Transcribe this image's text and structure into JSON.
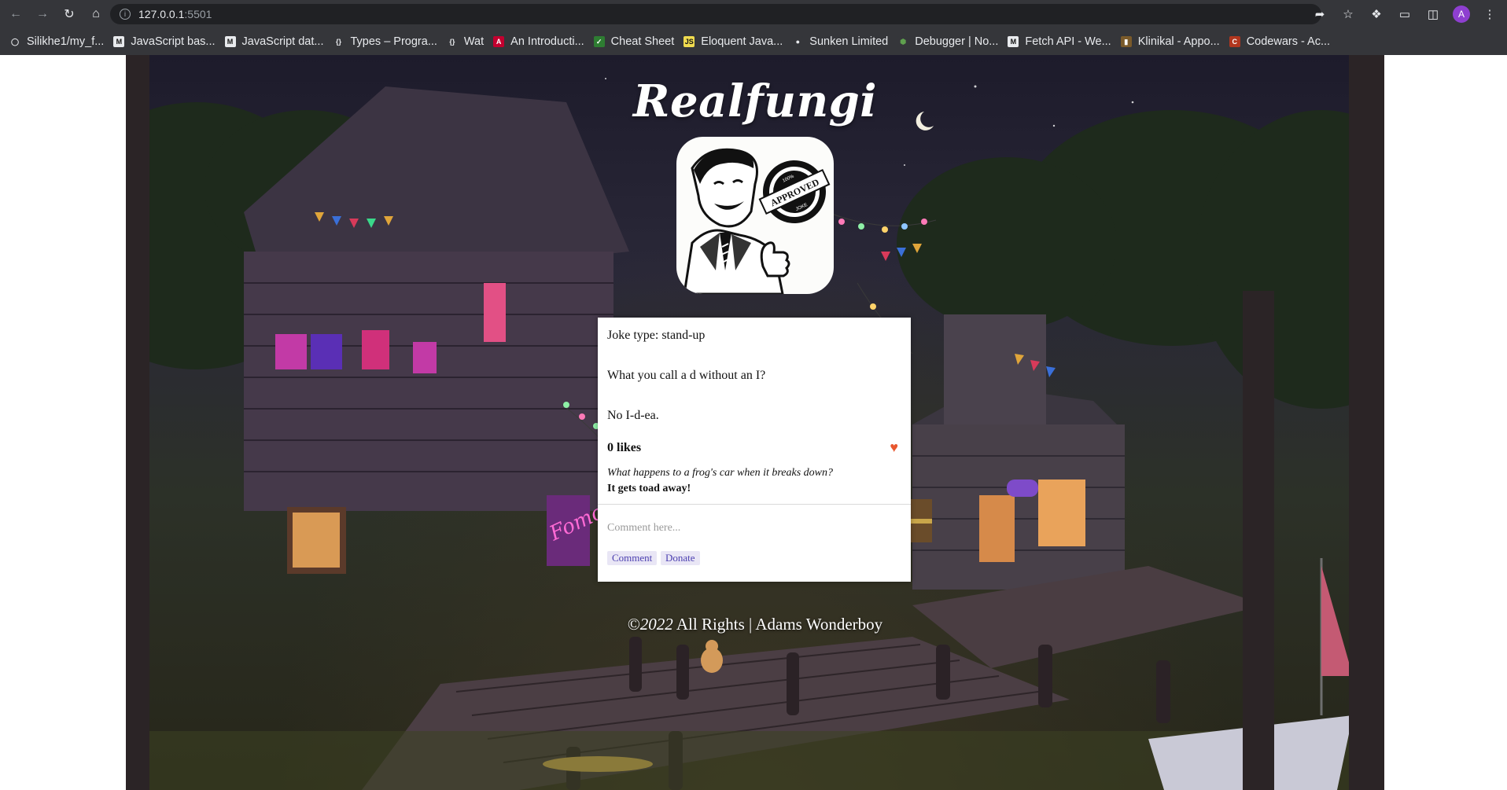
{
  "browser": {
    "url_host": "127.0.0.1",
    "url_port": ":5501",
    "avatar_letter": "A",
    "bookmarks": [
      {
        "label": "Silikhe1/my_f...",
        "icon": "github-icon",
        "glyph": "◯",
        "bg": "#35363a",
        "fg": "#e8eaed"
      },
      {
        "label": "JavaScript bas...",
        "icon": "medium-icon",
        "glyph": "M",
        "bg": "#e8eaed",
        "fg": "#111111"
      },
      {
        "label": "JavaScript dat...",
        "icon": "medium-icon",
        "glyph": "M",
        "bg": "#e8eaed",
        "fg": "#111111"
      },
      {
        "label": "Types – Progra...",
        "icon": "braces-icon",
        "glyph": "{}",
        "bg": "#35363a",
        "fg": "#e8eaed"
      },
      {
        "label": "Wat",
        "icon": "braces-icon",
        "glyph": "{}",
        "bg": "#35363a",
        "fg": "#e8eaed"
      },
      {
        "label": "An Introducti...",
        "icon": "angular-icon",
        "glyph": "A",
        "bg": "#c3002f",
        "fg": "#ffffff"
      },
      {
        "label": "Cheat Sheet",
        "icon": "leaf-icon",
        "glyph": "✓",
        "bg": "#2e7d32",
        "fg": "#ffffff"
      },
      {
        "label": "Eloquent Java...",
        "icon": "js-icon",
        "glyph": "JS",
        "bg": "#f0db4f",
        "fg": "#111111"
      },
      {
        "label": "Sunken Limited",
        "icon": "globe-icon",
        "glyph": "●",
        "bg": "#35363a",
        "fg": "#e8eaed"
      },
      {
        "label": "Debugger | No...",
        "icon": "node-icon",
        "glyph": "⬢",
        "bg": "#35363a",
        "fg": "#5fa04e"
      },
      {
        "label": "Fetch API - We...",
        "icon": "mdn-icon",
        "glyph": "M",
        "bg": "#e8eaed",
        "fg": "#111111"
      },
      {
        "label": "Klinikal - Appo...",
        "icon": "klinikal-icon",
        "glyph": "▮",
        "bg": "#7a5a2a",
        "fg": "#ffffff"
      },
      {
        "label": "Codewars - Ac...",
        "icon": "codewars-icon",
        "glyph": "C",
        "bg": "#b1361e",
        "fg": "#ffffff"
      }
    ]
  },
  "site": {
    "brand": "Realfungi",
    "logo_stamp_text": "APPROVED",
    "logo_stamp_top": "100%",
    "logo_stamp_bottom": "JOKE"
  },
  "joke_card": {
    "type_line": "Joke type: stand-up",
    "setup": "What you call a d without an I?",
    "punchline": "No I-d-ea.",
    "likes_label": "0 likes",
    "comment_setup": "What happens to a frog's car when it breaks down?",
    "comment_punchline": "It gets toad away!",
    "comment_placeholder": "Comment here...",
    "comment_button": "Comment",
    "donate_button": "Donate",
    "heart_color": "#e8572f"
  },
  "footer": {
    "copyright_symbol": "©",
    "year": "2022",
    "text": " All Rights | Adams Wonderboy"
  }
}
